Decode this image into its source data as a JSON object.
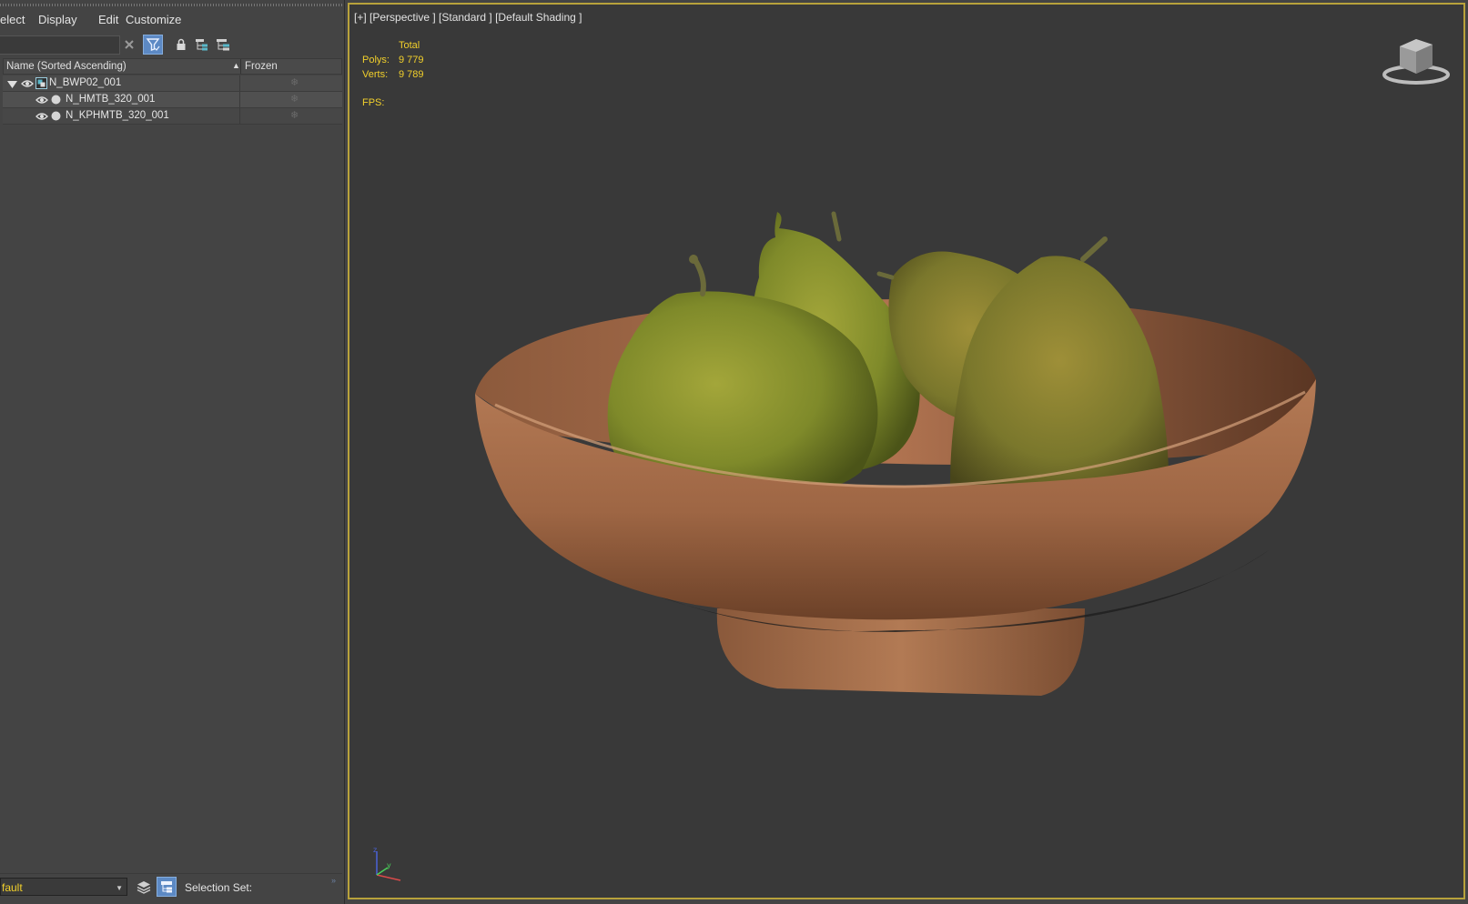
{
  "menubar": {
    "items": [
      "elect",
      "Display",
      "Edit",
      "Customize"
    ]
  },
  "toolbar": {
    "search_value": "",
    "icons": [
      "clear-search-icon",
      "filter-icon",
      "lock-icon",
      "hierarchy-icon",
      "layer-hierarchy-icon"
    ]
  },
  "explorer": {
    "column_name": "Name (Sorted Ascending)",
    "column_frozen": "Frozen",
    "sort_indicator": "▲",
    "rows": [
      {
        "label": "N_BWP02_001",
        "expanded": true
      },
      {
        "label": "N_HMTB_320_001"
      },
      {
        "label": "N_KPHMTB_320_001"
      }
    ],
    "frozen_glyph": "❄"
  },
  "bottom": {
    "layer_value": "fault",
    "selection_set_label": "Selection Set:"
  },
  "viewport": {
    "label": "[+] [Perspective ] [Standard ] [Default Shading ]",
    "stats": {
      "header": "Total",
      "polys_label": "Polys:",
      "polys_value": "9 779",
      "verts_label": "Verts:",
      "verts_value": "9 789",
      "fps_label": "FPS:"
    },
    "active_border_color": "#b8a23b",
    "stats_color": "#f2d02b"
  }
}
